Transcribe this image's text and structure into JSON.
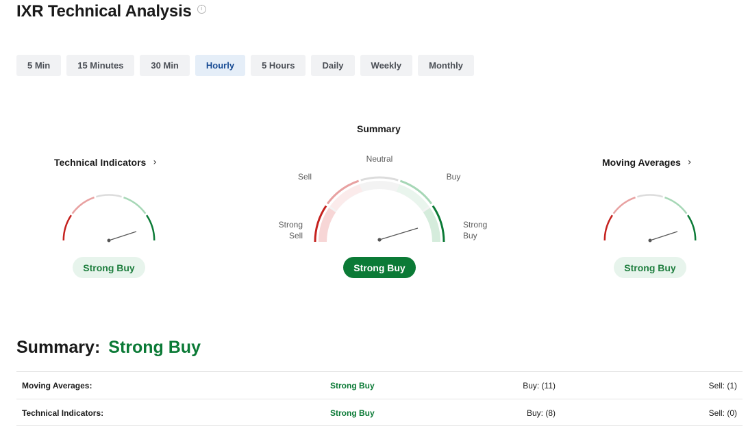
{
  "header": {
    "title": "IXR Technical Analysis",
    "info_icon": "info-icon"
  },
  "tabs": [
    {
      "label": "5 Min",
      "active": false
    },
    {
      "label": "15 Minutes",
      "active": false
    },
    {
      "label": "30 Min",
      "active": false
    },
    {
      "label": "Hourly",
      "active": true
    },
    {
      "label": "5 Hours",
      "active": false
    },
    {
      "label": "Daily",
      "active": false
    },
    {
      "label": "Weekly",
      "active": false
    },
    {
      "label": "Monthly",
      "active": false
    }
  ],
  "gauges": {
    "summary": {
      "title": "Summary",
      "labels": {
        "neutral": "Neutral",
        "sell": "Sell",
        "buy": "Buy",
        "strong_sell_1": "Strong",
        "strong_sell_2": "Sell",
        "strong_buy_1": "Strong",
        "strong_buy_2": "Buy"
      },
      "signal": "Strong Buy"
    },
    "technical_indicators": {
      "title": "Technical Indicators",
      "signal": "Strong Buy"
    },
    "moving_averages": {
      "title": "Moving Averages",
      "signal": "Strong Buy"
    }
  },
  "colors": {
    "strong_sell": "#c5221f",
    "sell": "#e8a1a1",
    "neutral": "#dcdcdc",
    "buy": "#a6d7b6",
    "strong_buy": "#0b7a36",
    "active_tab_bg": "#e5eef8",
    "active_tab_text": "#174b94"
  },
  "summary": {
    "label": "Summary:",
    "value": "Strong Buy",
    "rows": [
      {
        "name": "Moving Averages:",
        "signal": "Strong Buy",
        "buy": "Buy: (11)",
        "sell": "Sell: (1)"
      },
      {
        "name": "Technical Indicators:",
        "signal": "Strong Buy",
        "buy": "Buy: (8)",
        "sell": "Sell: (0)"
      }
    ]
  }
}
